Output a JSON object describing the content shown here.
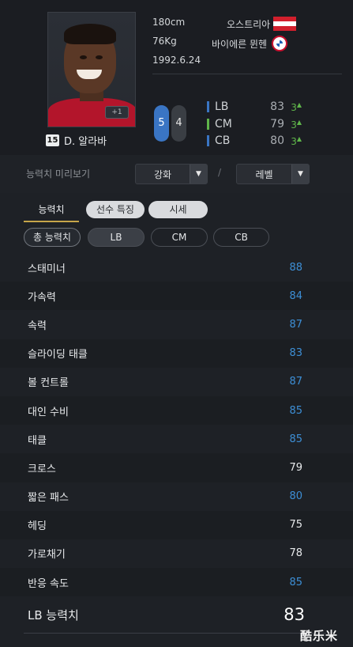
{
  "player": {
    "name": "D. 알라바",
    "season_badge": "15",
    "height": "180cm",
    "weight": "76Kg",
    "birthdate": "1992.6.24",
    "nation": "오스트리아",
    "club": "바이에른 뮌헨",
    "upgrade_badge": "+1",
    "left_foot": "5",
    "right_foot": "4"
  },
  "positions": [
    {
      "name": "LB",
      "value": "83",
      "delta": "3",
      "color": "#3a75c4"
    },
    {
      "name": "CM",
      "value": "79",
      "delta": "3",
      "color": "#5fb54a"
    },
    {
      "name": "CB",
      "value": "80",
      "delta": "3",
      "color": "#3a75c4"
    }
  ],
  "preview": {
    "label": "능력치 미리보기",
    "enhance": "강화",
    "separator": "/",
    "level": "레벨"
  },
  "tabs": {
    "ability": "능력치",
    "traits": "선수 특징",
    "price": "시세"
  },
  "subtabs": {
    "total": "총 능력치",
    "lb": "LB",
    "cm": "CM",
    "cb": "CB"
  },
  "stats": [
    {
      "name": "스태미너",
      "value": "88",
      "highlight": true
    },
    {
      "name": "가속력",
      "value": "84",
      "highlight": true
    },
    {
      "name": "속력",
      "value": "87",
      "highlight": true
    },
    {
      "name": "슬라이딩 태클",
      "value": "83",
      "highlight": true
    },
    {
      "name": "볼 컨트롤",
      "value": "87",
      "highlight": true
    },
    {
      "name": "대인 수비",
      "value": "85",
      "highlight": true
    },
    {
      "name": "태클",
      "value": "85",
      "highlight": true
    },
    {
      "name": "크로스",
      "value": "79",
      "highlight": false
    },
    {
      "name": "짧은 패스",
      "value": "80",
      "highlight": true
    },
    {
      "name": "헤딩",
      "value": "75",
      "highlight": false
    },
    {
      "name": "가로채기",
      "value": "78",
      "highlight": false
    },
    {
      "name": "반응 속도",
      "value": "85",
      "highlight": true
    }
  ],
  "overall": {
    "label": "LB 능력치",
    "value": "83"
  },
  "watermark": "酷乐米",
  "colors": {
    "stat_highlight": "#3d8fd6",
    "stat_normal": "#e8eaec",
    "accent_gold": "#c6a54a"
  }
}
